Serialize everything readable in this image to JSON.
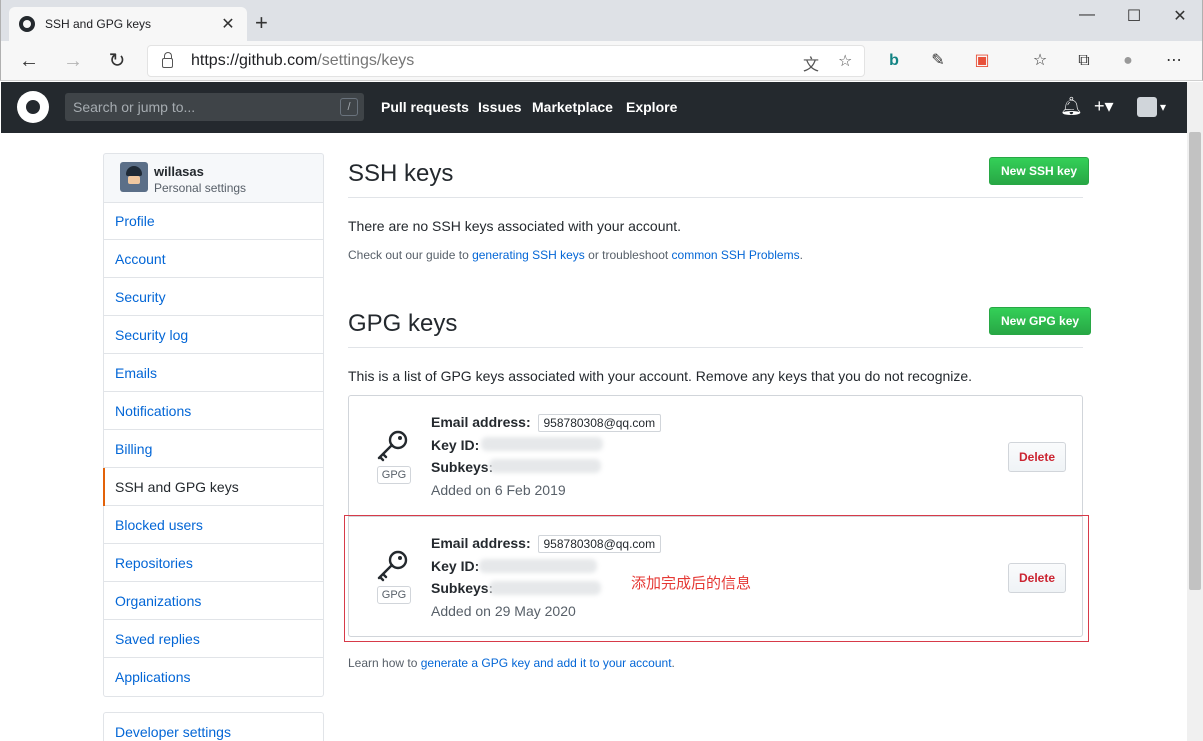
{
  "browser": {
    "tab_title": "SSH and GPG keys",
    "url_host": "https://github.com",
    "url_path": "/settings/keys",
    "icons": [
      "back-icon",
      "forward-icon",
      "refresh-icon",
      "lock-icon",
      "translate-icon",
      "star-icon",
      "bing-icon",
      "pin-icon",
      "extension-icon",
      "favorites-icon",
      "collections-icon",
      "profile-icon",
      "more-icon"
    ]
  },
  "header": {
    "search_placeholder": "Search or jump to...",
    "search_shortcut": "/",
    "nav": [
      "Pull requests",
      "Issues",
      "Marketplace",
      "Explore"
    ]
  },
  "sidebar": {
    "username": "willasas",
    "subtitle": "Personal settings",
    "items": [
      {
        "label": "Profile"
      },
      {
        "label": "Account"
      },
      {
        "label": "Security"
      },
      {
        "label": "Security log"
      },
      {
        "label": "Emails"
      },
      {
        "label": "Notifications"
      },
      {
        "label": "Billing"
      },
      {
        "label": "SSH and GPG keys",
        "selected": true
      },
      {
        "label": "Blocked users"
      },
      {
        "label": "Repositories"
      },
      {
        "label": "Organizations"
      },
      {
        "label": "Saved replies"
      },
      {
        "label": "Applications"
      }
    ],
    "developer_settings": "Developer settings"
  },
  "ssh": {
    "title": "SSH keys",
    "new_button": "New SSH key",
    "empty_text": "There are no SSH keys associated with your account.",
    "guide_prefix": "Check out our guide to ",
    "guide_link1": "generating SSH keys",
    "guide_mid": " or troubleshoot ",
    "guide_link2": "common SSH Problems",
    "guide_suffix": "."
  },
  "gpg": {
    "title": "GPG keys",
    "new_button": "New GPG key",
    "intro": "This is a list of GPG keys associated with your account. Remove any keys that you do not recognize.",
    "email_label": "Email address:",
    "keyid_label": "Key ID:",
    "subkeys_label": "Subkeys:",
    "badge": "GPG",
    "delete_label": "Delete",
    "keys": [
      {
        "email": "958780308@qq.com",
        "added": "Added on 6 Feb 2019"
      },
      {
        "email": "958780308@qq.com",
        "added": "Added on 29 May 2020"
      }
    ],
    "footer_prefix": "Learn how to ",
    "footer_link": "generate a GPG key and add it to your account",
    "footer_suffix": "."
  },
  "annotation": "添加完成后的信息",
  "colors": {
    "accent_green": "#2ea44f",
    "link_blue": "#0366d6",
    "selected_marker": "#e36209",
    "danger_red": "#cb2431",
    "annotation_red": "#e53935"
  }
}
